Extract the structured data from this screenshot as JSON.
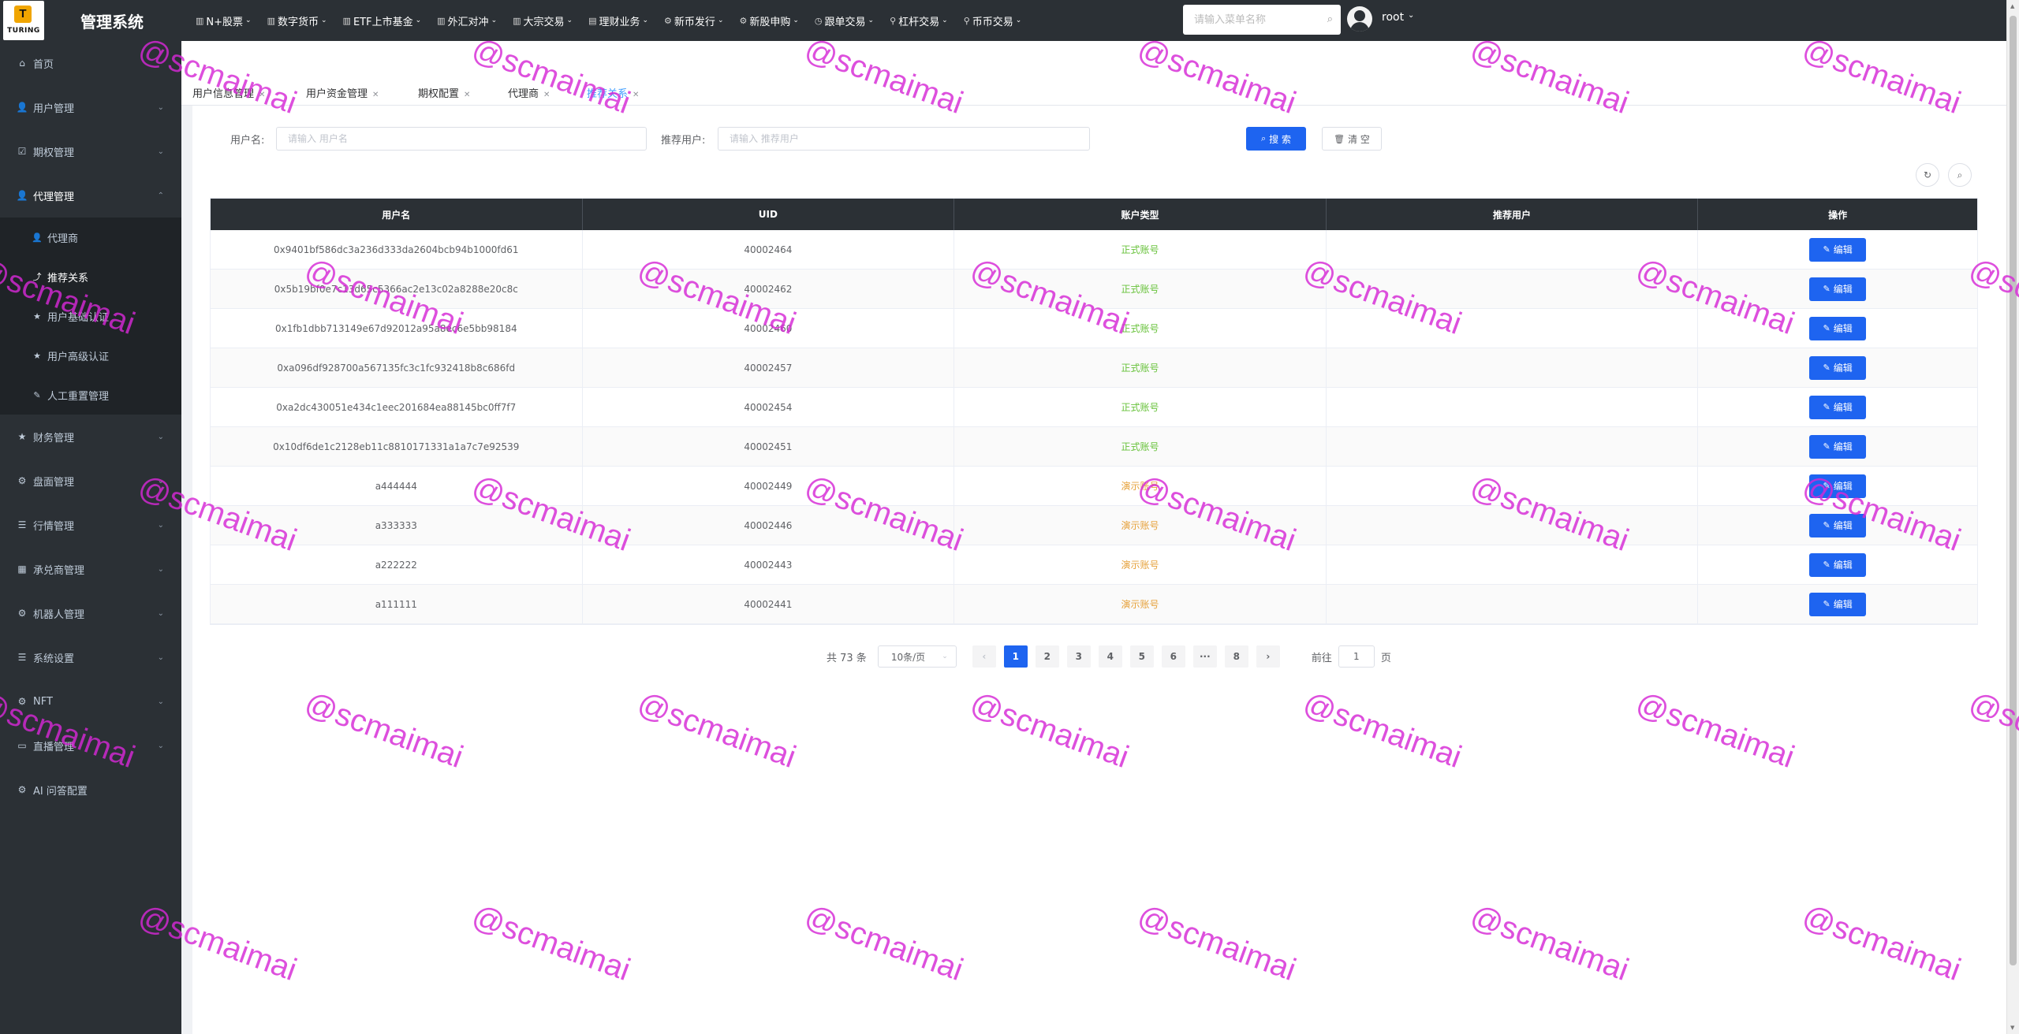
{
  "app": {
    "title": "管理系统",
    "logo_text": "TURING",
    "logo_letter": "T"
  },
  "topnav": [
    {
      "label": "N+股票",
      "icon": "bar-chart-icon"
    },
    {
      "label": "数字货币",
      "icon": "bar-chart-icon"
    },
    {
      "label": "ETF上市基金",
      "icon": "bar-chart-icon"
    },
    {
      "label": "外汇对冲",
      "icon": "bar-chart-icon"
    },
    {
      "label": "大宗交易",
      "icon": "bar-chart-icon"
    },
    {
      "label": "理财业务",
      "icon": "wallet-icon"
    },
    {
      "label": "新币发行",
      "icon": "settings-icon"
    },
    {
      "label": "新股申购",
      "icon": "settings-icon"
    },
    {
      "label": "跟单交易",
      "icon": "clock-icon"
    },
    {
      "label": "杠杆交易",
      "icon": "lever-icon"
    },
    {
      "label": "币币交易",
      "icon": "pin-icon"
    }
  ],
  "header": {
    "search_placeholder": "请输入菜单名称",
    "user": "root"
  },
  "sidebar": {
    "items": [
      {
        "label": "首页",
        "icon": "home-icon",
        "chev": ""
      },
      {
        "label": "用户管理",
        "icon": "user-icon",
        "chev": "⌄"
      },
      {
        "label": "期权管理",
        "icon": "check-icon",
        "chev": "⌄"
      },
      {
        "label": "代理管理",
        "icon": "user-icon",
        "chev": "⌃"
      },
      {
        "label": "财务管理",
        "icon": "star-icon",
        "chev": "⌄"
      },
      {
        "label": "盘面管理",
        "icon": "settings-icon",
        "chev": "⌄"
      },
      {
        "label": "行情管理",
        "icon": "list-icon",
        "chev": "⌄"
      },
      {
        "label": "承兑商管理",
        "icon": "table-icon",
        "chev": "⌄"
      },
      {
        "label": "机器人管理",
        "icon": "settings-icon",
        "chev": "⌄"
      },
      {
        "label": "系统设置",
        "icon": "list-icon",
        "chev": "⌄"
      },
      {
        "label": "NFT",
        "icon": "settings-icon",
        "chev": "⌄"
      },
      {
        "label": "直播管理",
        "icon": "video-icon",
        "chev": "⌄"
      },
      {
        "label": "AI 问答配置",
        "icon": "settings-icon",
        "chev": ""
      }
    ],
    "sub_items": [
      {
        "label": "代理商",
        "icon": "user-icon"
      },
      {
        "label": "推荐关系",
        "icon": "share-icon"
      },
      {
        "label": "用户基础认证",
        "icon": "star-icon"
      },
      {
        "label": "用户高级认证",
        "icon": "star-icon"
      },
      {
        "label": "人工重置管理",
        "icon": "edit-icon"
      }
    ]
  },
  "tabs": [
    {
      "label": "用户信息管理"
    },
    {
      "label": "用户资金管理"
    },
    {
      "label": "期权配置"
    },
    {
      "label": "代理商"
    },
    {
      "label": "推荐关系"
    }
  ],
  "filters": {
    "username_label": "用户名:",
    "username_placeholder": "请输入 用户名",
    "referrer_label": "推荐用户:",
    "referrer_placeholder": "请输入 推荐用户",
    "search_label": "搜 索",
    "reset_label": "清 空"
  },
  "table": {
    "columns": [
      "用户名",
      "UID",
      "账户类型",
      "推荐用户",
      "操作"
    ],
    "edit_label": "编辑",
    "rows": [
      {
        "username": "0x9401bf586dc3a236d333da2604bcb94b1000fd61",
        "uid": "40002464",
        "type": "正式账号",
        "type_kind": "ok",
        "referrer": ""
      },
      {
        "username": "0x5b19bf0e7c13d65c5366ac2e13c02a8288e20c8c",
        "uid": "40002462",
        "type": "正式账号",
        "type_kind": "ok",
        "referrer": ""
      },
      {
        "username": "0x1fb1dbb713149e67d92012a95a8ec6e5bb98184",
        "uid": "40002460",
        "type": "正式账号",
        "type_kind": "ok",
        "referrer": ""
      },
      {
        "username": "0xa096df928700a567135fc3c1fc932418b8c686fd",
        "uid": "40002457",
        "type": "正式账号",
        "type_kind": "ok",
        "referrer": ""
      },
      {
        "username": "0xa2dc430051e434c1eec201684ea88145bc0ff7f7",
        "uid": "40002454",
        "type": "正式账号",
        "type_kind": "ok",
        "referrer": ""
      },
      {
        "username": "0x10df6de1c2128eb11c8810171331a1a7c7e92539",
        "uid": "40002451",
        "type": "正式账号",
        "type_kind": "ok",
        "referrer": ""
      },
      {
        "username": "a444444",
        "uid": "40002449",
        "type": "演示账号",
        "type_kind": "demo",
        "referrer": ""
      },
      {
        "username": "a333333",
        "uid": "40002446",
        "type": "演示账号",
        "type_kind": "demo",
        "referrer": ""
      },
      {
        "username": "a222222",
        "uid": "40002443",
        "type": "演示账号",
        "type_kind": "demo",
        "referrer": ""
      },
      {
        "username": "a111111",
        "uid": "40002441",
        "type": "演示账号",
        "type_kind": "demo",
        "referrer": ""
      }
    ]
  },
  "pagination": {
    "total": "共 73 条",
    "page_size": "10条/页",
    "pages": [
      "1",
      "2",
      "3",
      "4",
      "5",
      "6",
      "···",
      "8"
    ],
    "current": "1",
    "goto_label": "前往",
    "goto_value": "1",
    "page_unit": "页"
  },
  "watermark": "@scmaimai",
  "colors": {
    "dark_bg": "#2b3035",
    "primary": "#1e64f0",
    "official": "#67c23a",
    "demo": "#e6a23c",
    "watermark": "#d628d6"
  }
}
